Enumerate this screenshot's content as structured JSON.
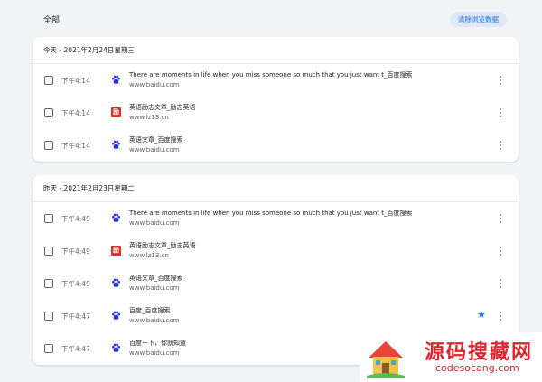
{
  "header": {
    "title": "全部",
    "clear_button": "清除浏览数据"
  },
  "groups": [
    {
      "date": "今天 - 2021年2月24日星期三",
      "items": [
        {
          "time": "下午4:14",
          "title": "There are moments in life when you miss someone so much that you just want t_百度搜索",
          "domain": "www.baidu.com",
          "favicon": "baidu-paw-icon",
          "starred": false
        },
        {
          "time": "下午4:14",
          "title": "英语励志文章_励志英语",
          "domain": "www.lz13.cn",
          "favicon": "lz13-icon",
          "starred": false
        },
        {
          "time": "下午4:14",
          "title": "英语文章_百度搜索",
          "domain": "www.baidu.com",
          "favicon": "baidu-paw-icon",
          "starred": false
        }
      ]
    },
    {
      "date": "昨天 - 2021年2月23日星期二",
      "items": [
        {
          "time": "下午4:49",
          "title": "There are moments in life when you miss someone so much that you just want t_百度搜索",
          "domain": "www.baidu.com",
          "favicon": "baidu-paw-icon",
          "starred": false
        },
        {
          "time": "下午4:49",
          "title": "英语励志文章_励志英语",
          "domain": "www.lz13.cn",
          "favicon": "lz13-icon",
          "starred": false
        },
        {
          "time": "下午4:49",
          "title": "英语文章_百度搜索",
          "domain": "www.baidu.com",
          "favicon": "baidu-paw-icon",
          "starred": false
        },
        {
          "time": "下午4:47",
          "title": "百度_百度搜索",
          "domain": "www.baidu.com",
          "favicon": "baidu-paw-icon",
          "starred": true
        },
        {
          "time": "下午4:47",
          "title": "百度一下，你就知道",
          "domain": "www.baidu.com",
          "favicon": "baidu-paw-icon",
          "starred": false
        }
      ]
    }
  ],
  "lz13_favicon_glyph": "励",
  "watermark": {
    "text": "源码搜藏网",
    "url": "codesocang.com"
  },
  "colors": {
    "accent": "#1a73e8",
    "background": "#f1f3f4",
    "watermark": "#d9262f"
  }
}
